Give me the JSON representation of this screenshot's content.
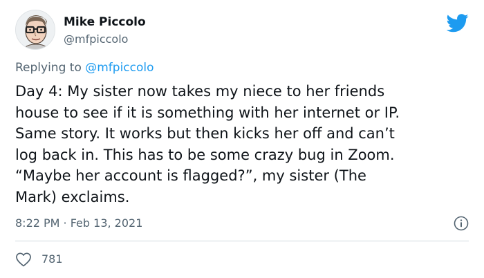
{
  "author": {
    "display_name": "Mike Piccolo",
    "handle": "@mfpiccolo",
    "avatar_icon": "cartoon-face-with-glasses-avatar"
  },
  "reply": {
    "prefix": "Replying to ",
    "mention": "@mfpiccolo"
  },
  "tweet": {
    "text": "Day 4: My sister now takes my niece to her friends\nhouse to see if it is something with her internet or IP.\nSame story. It works but then kicks her off and can’t\nlog back in. This has to be some crazy bug in Zoom.\n“Maybe her account is flagged?”, my sister (The\nMark) exclaims.",
    "timestamp": "8:22 PM · Feb 13, 2021"
  },
  "engagement": {
    "likes": "781"
  },
  "icons": {
    "brand": "twitter-bird-icon",
    "info": "info-icon",
    "like": "heart-icon"
  },
  "colors": {
    "brand_blue": "#1d9bf0",
    "secondary_text": "#536471",
    "primary_text": "#0f1419",
    "divider": "#cfd9de"
  }
}
